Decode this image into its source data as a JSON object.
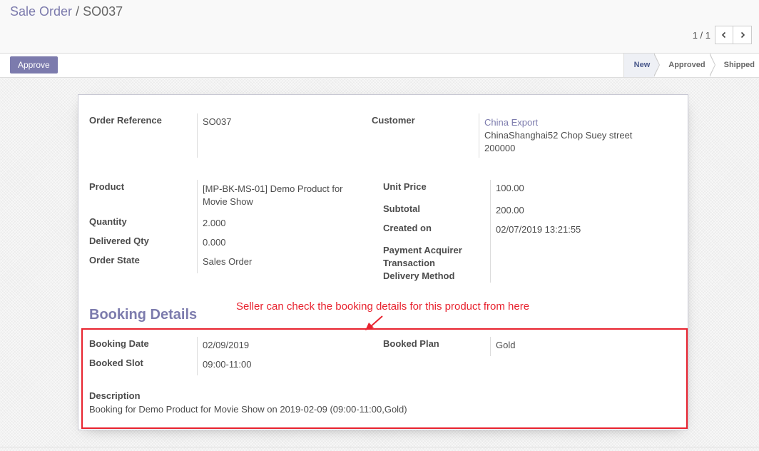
{
  "breadcrumb": {
    "parent": "Sale Order",
    "separator": "/",
    "current": "SO037"
  },
  "pager": {
    "value": "1 / 1",
    "prev_icon": "chevron-left-icon",
    "next_icon": "chevron-right-icon"
  },
  "actions": {
    "approve_label": "Approve"
  },
  "statusbar": {
    "stages": [
      {
        "label": "New",
        "active": true
      },
      {
        "label": "Approved",
        "active": false
      },
      {
        "label": "Shipped",
        "active": false
      }
    ]
  },
  "order": {
    "order_reference_label": "Order Reference",
    "order_reference": "SO037",
    "customer_label": "Customer",
    "customer_name": "China Export",
    "customer_address_line1": "ChinaShanghai52 Chop Suey street",
    "customer_address_line2": "200000",
    "product_label": "Product",
    "product_line1": "[MP-BK-MS-01] Demo Product for",
    "product_line2": "Movie Show",
    "quantity_label": "Quantity",
    "quantity": "2.000",
    "delivered_qty_label": "Delivered Qty",
    "delivered_qty": "0.000",
    "order_state_label": "Order State",
    "order_state": "Sales Order",
    "unit_price_label": "Unit Price",
    "unit_price": "100.00",
    "subtotal_label": "Subtotal",
    "subtotal": "200.00",
    "created_on_label": "Created on",
    "created_on": "02/07/2019 13:21:55",
    "payment_acquirer_label": "Payment Acquirer",
    "transaction_label": "Transaction",
    "delivery_method_label": "Delivery Method"
  },
  "booking": {
    "heading": "Booking Details",
    "booking_date_label": "Booking Date",
    "booking_date": "02/09/2019",
    "booked_slot_label": "Booked Slot",
    "booked_slot": "09:00-11:00",
    "booked_plan_label": "Booked Plan",
    "booked_plan": "Gold",
    "description_label": "Description",
    "description": "Booking for Demo Product for Movie Show on 2019-02-09 (09:00-11:00,Gold)"
  },
  "annotation": {
    "text": "Seller can check the booking details for this product from here",
    "color": "#e8232f"
  },
  "colors": {
    "accent": "#7c7bad",
    "annotation": "#e8232f"
  }
}
